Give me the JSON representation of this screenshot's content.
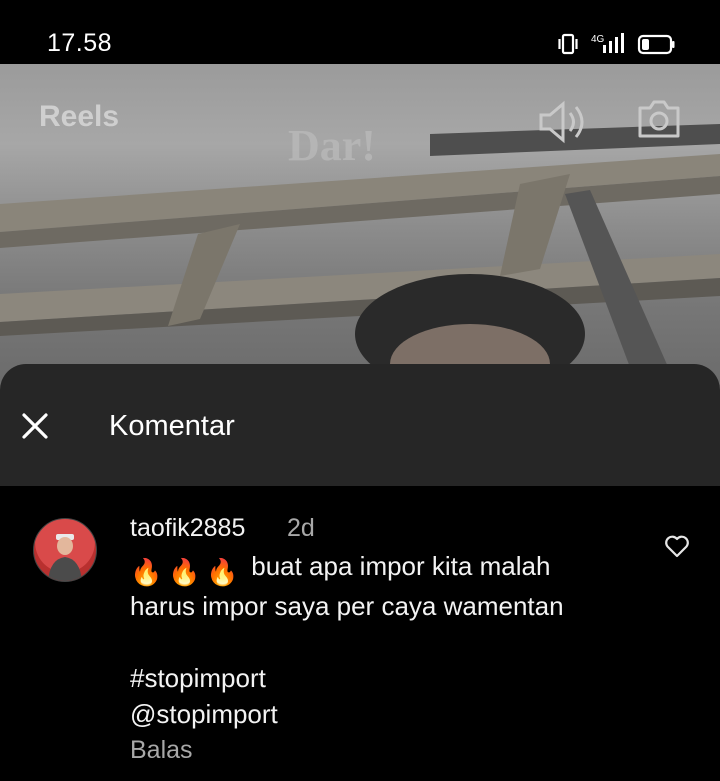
{
  "status_bar": {
    "time": "17.58",
    "network_label": "4G",
    "icons": [
      "vibrate-icon",
      "signal-icon",
      "battery-icon"
    ]
  },
  "video": {
    "reels_label": "Reels",
    "icons": [
      "speaker-icon",
      "camera-icon"
    ]
  },
  "comments_sheet": {
    "title": "Komentar",
    "close_icon": "close-icon",
    "comment": {
      "username": "taofik2885",
      "time_ago": "2d",
      "emoji": [
        "🔥",
        "🔥",
        "🔥"
      ],
      "text_line1": "buat apa impor kita malah",
      "text_line2": "harus impor saya per caya wamentan",
      "hashtag": "#stopimport",
      "mention": "@stopimport",
      "reply_label": "Balas",
      "like_icon": "heart-outline-icon"
    }
  }
}
